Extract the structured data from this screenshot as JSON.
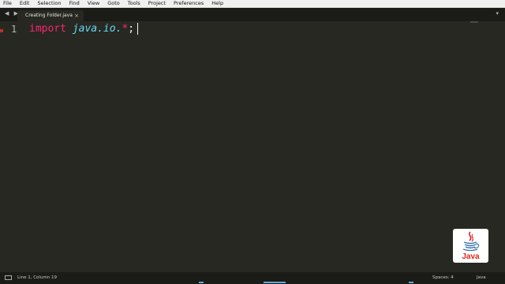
{
  "menubar": {
    "items": [
      "File",
      "Edit",
      "Selection",
      "Find",
      "View",
      "Goto",
      "Tools",
      "Project",
      "Preferences",
      "Help"
    ]
  },
  "tabbar": {
    "nav_arrows": "◀ ▶",
    "active_tab": "Creating Folder.java",
    "close_glyph": "×",
    "dropdown_glyph": "▾"
  },
  "editor": {
    "line_number": "1",
    "code": {
      "keyword": "import",
      "package": "java.io.",
      "star": "*",
      "semicolon": ";"
    }
  },
  "logo": {
    "text": "Java"
  },
  "status": {
    "position": "Line 1, Column 19",
    "spaces": "Spaces: 4",
    "syntax": "Java"
  },
  "colors": {
    "background": "#272822",
    "keyword": "#f92672",
    "package": "#66d9ef",
    "java_red": "#e2231a",
    "java_blue": "#3a75b0"
  }
}
